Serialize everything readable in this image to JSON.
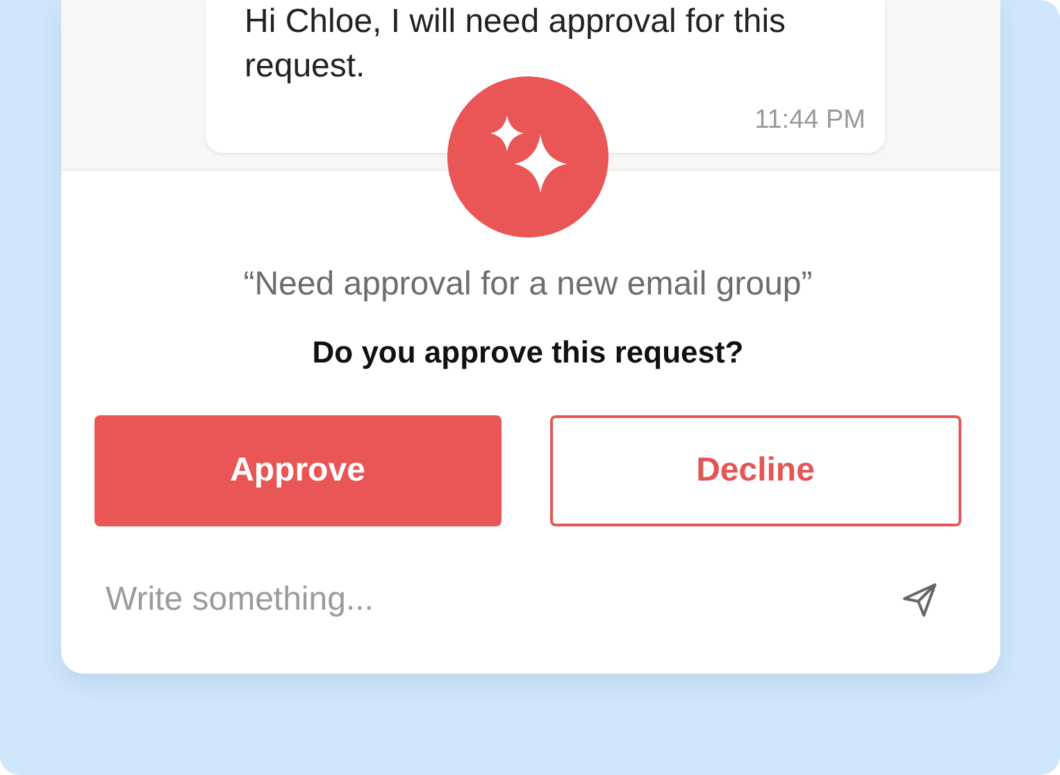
{
  "message": {
    "text": "Hi Chloe, I will need approval for this request.",
    "time": "11:44 PM"
  },
  "request": {
    "quote": "“Need approval for a new email group”",
    "question": "Do you approve this request?"
  },
  "buttons": [
    {
      "label": "Approve",
      "kind": "primary"
    },
    {
      "label": "Decline",
      "kind": "secondary"
    }
  ],
  "composer": {
    "placeholder": "Write something..."
  }
}
